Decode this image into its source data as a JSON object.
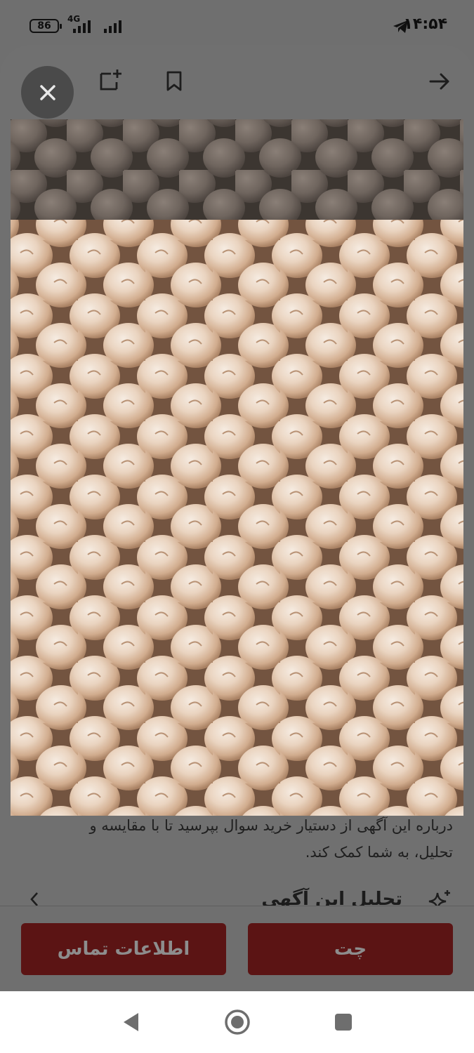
{
  "status_bar": {
    "battery": "86",
    "network": "4G",
    "time": "۱۴:۵۴"
  },
  "toolbar": {
    "icons": [
      "close-icon",
      "add-note-icon",
      "bookmark-icon",
      "back-arrow-icon"
    ]
  },
  "photo": {
    "subject": "chickpeas"
  },
  "description": {
    "line1": "درباره این آگهی از دستیار خرید سوال بپرسید تا با مقایسه و",
    "line2": "تحلیل، به شما کمک کند."
  },
  "analysis": {
    "label": "تحلیل این آگهی"
  },
  "actions": {
    "chat_label": "چت",
    "contact_label": "اطلاعات تماس"
  },
  "colors": {
    "accent": "#5b1414",
    "scrim": "#6f6f6f",
    "nav_bg": "#ffffff"
  }
}
